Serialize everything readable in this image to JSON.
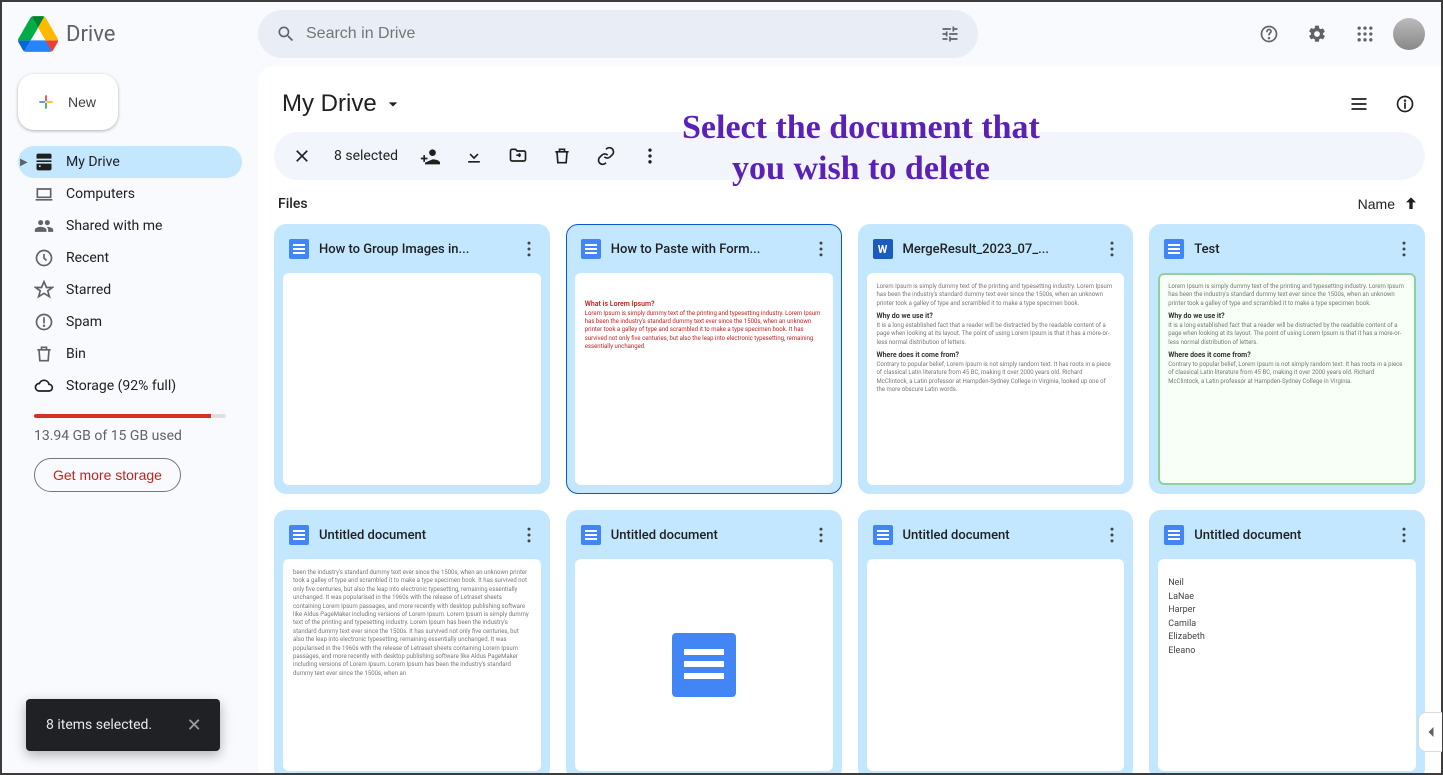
{
  "app": {
    "title": "Drive"
  },
  "search": {
    "placeholder": "Search in Drive"
  },
  "sidebar": {
    "new_label": "New",
    "items": [
      {
        "label": "My Drive"
      },
      {
        "label": "Computers"
      },
      {
        "label": "Shared with me"
      },
      {
        "label": "Recent"
      },
      {
        "label": "Starred"
      },
      {
        "label": "Spam"
      },
      {
        "label": "Bin"
      }
    ],
    "storage_nav": "Storage (92% full)",
    "storage_used": "13.94 GB of 15 GB used",
    "more_storage": "Get more storage"
  },
  "main": {
    "breadcrumb": "My Drive",
    "selection_count": "8 selected",
    "files_label": "Files",
    "sort_label": "Name"
  },
  "files": [
    {
      "title": "How to Group Images in...",
      "type": "gdoc"
    },
    {
      "title": "How to Paste with Form...",
      "type": "gdoc"
    },
    {
      "title": "MergeResult_2023_07_...",
      "type": "docx"
    },
    {
      "title": "Test",
      "type": "gdoc"
    },
    {
      "title": "Untitled document",
      "type": "gdoc"
    },
    {
      "title": "Untitled document",
      "type": "gdoc"
    },
    {
      "title": "Untitled document",
      "type": "gdoc"
    },
    {
      "title": "Untitled document",
      "type": "gdoc"
    }
  ],
  "annotation": {
    "line1": "Select the document that",
    "line2": "you wish to delete"
  },
  "toast": {
    "text": "8 items selected."
  },
  "thumb_names": [
    "Neil",
    "LaNae",
    "Harper",
    "Camila",
    "Elizabeth",
    "Eleano"
  ]
}
